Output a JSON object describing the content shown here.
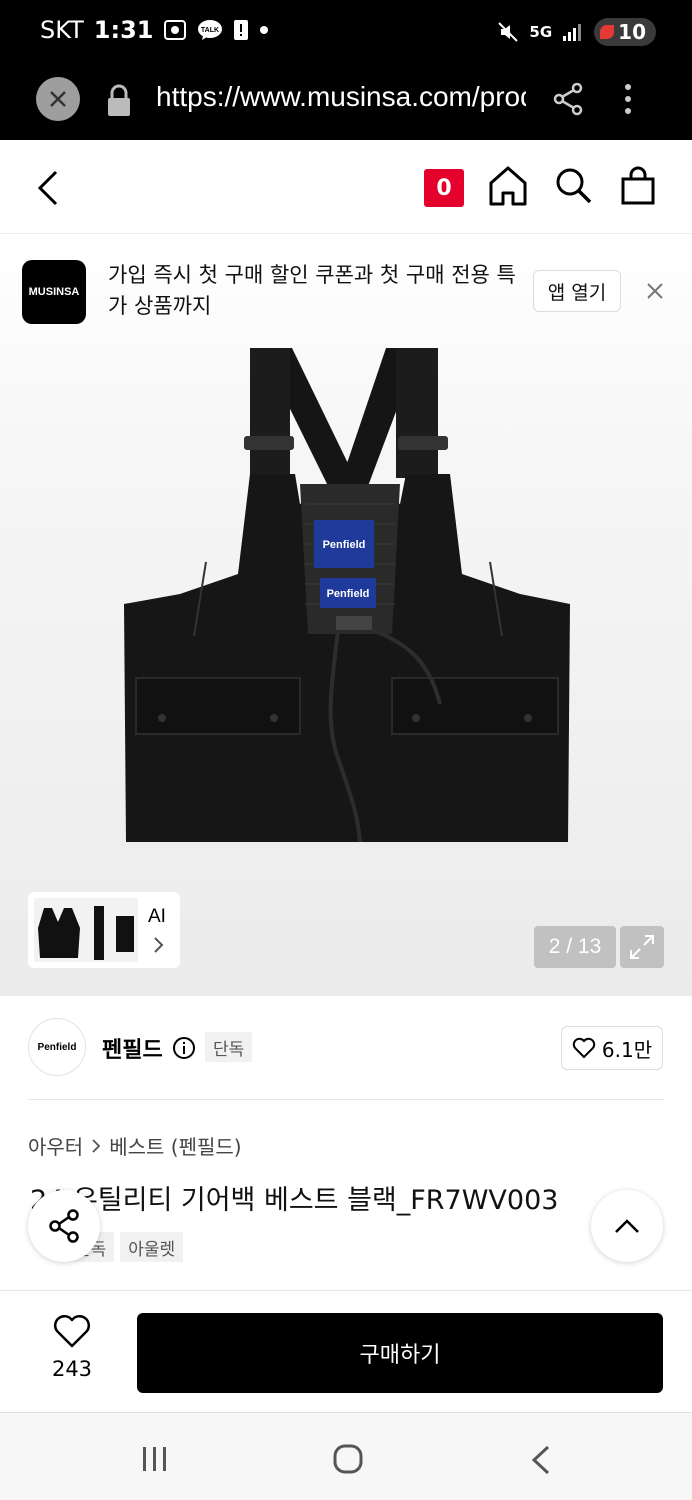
{
  "status_bar": {
    "carrier": "SKT",
    "time": "1:31",
    "network": "5G",
    "battery": "10"
  },
  "browser": {
    "url": "https://www.musinsa.com/products"
  },
  "header": {
    "cart_count": "0"
  },
  "app_banner": {
    "logo_text": "MUSINSA",
    "message": "가입 즉시 첫 구매 할인 쿠폰과 첫 구매 전용 특가 상품까지",
    "open_label": "앱 열기"
  },
  "gallery": {
    "patch_brand": "Penfield",
    "ai_label": "AI",
    "counter": "2 / 13"
  },
  "brand": {
    "logo_text": "Penfield",
    "name": "펜필드",
    "exclusive_tag": "단독",
    "likes": "6.1만"
  },
  "product": {
    "breadcrumb": [
      "아우터",
      "베스트 (펜필드)"
    ],
    "title": "24 유틸리티 기어백 베스트 블랙_FR7WV003",
    "tags": [
      "단독",
      "아울렛"
    ]
  },
  "action_bar": {
    "wish_count": "243",
    "buy_label": "구매하기"
  },
  "colors": {
    "accent_red": "#e4022d",
    "black": "#000000"
  }
}
